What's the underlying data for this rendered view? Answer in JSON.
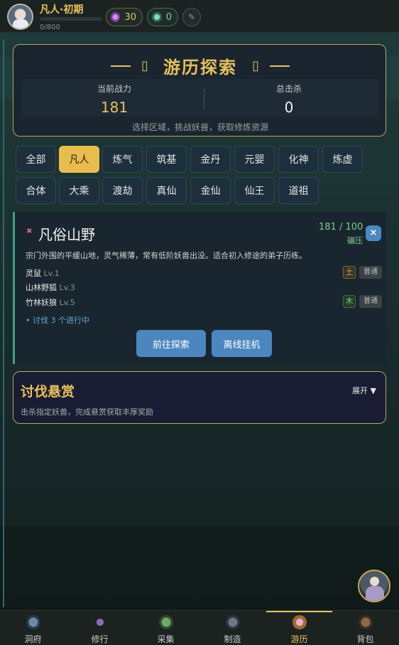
{
  "player": {
    "realm": "凡人·初期",
    "xp_text": "0/800",
    "xp_fraction": 0
  },
  "currency": {
    "spirit_stones": "30",
    "jade": "0"
  },
  "header": {
    "title": "游历探索",
    "bracket_left": "▯",
    "bracket_right": "▯",
    "combat_power_label": "当前战力",
    "combat_power_value": "181",
    "total_kills_label": "总击杀",
    "total_kills_value": "0",
    "hint": "选择区域，挑战妖兽，获取修炼资源"
  },
  "realm_tabs": [
    {
      "label": "全部"
    },
    {
      "label": "凡人"
    },
    {
      "label": "炼气"
    },
    {
      "label": "筑基"
    },
    {
      "label": "金丹"
    },
    {
      "label": "元婴"
    },
    {
      "label": "化神"
    },
    {
      "label": "炼虚"
    },
    {
      "label": "合体"
    },
    {
      "label": "大乘"
    },
    {
      "label": "渡劫"
    },
    {
      "label": "真仙"
    },
    {
      "label": "金仙"
    },
    {
      "label": "仙王"
    },
    {
      "label": "道祖"
    }
  ],
  "active_tab": "凡人",
  "zone": {
    "name": "凡俗山野",
    "power_ratio": "181 / 100",
    "status": "碾压",
    "close_symbol": "×",
    "description": "宗门外围的平缓山地，灵气稀薄，常有低阶妖兽出没。适合初入修途的弟子历练。",
    "monsters": [
      {
        "name": "灵鼠",
        "level": "Lv.1",
        "element": "土",
        "tier": "普通"
      },
      {
        "name": "山林野狐",
        "level": "Lv.3",
        "element": "",
        "tier": ""
      },
      {
        "name": "竹林妖狼",
        "level": "Lv.5",
        "element": "木",
        "tier": "普通"
      }
    ],
    "quest_note": "• 讨伐 3 个进行中",
    "explore_button": "前往探索",
    "afk_button": "离线挂机"
  },
  "bounty": {
    "title": "讨伐悬赏",
    "expand": "展开 ▼",
    "description": "击杀指定妖兽，完成悬赏获取丰厚奖励"
  },
  "bottom_nav": [
    {
      "label": "洞府",
      "icon": "cave-icon"
    },
    {
      "label": "修行",
      "icon": "cultivate-icon"
    },
    {
      "label": "采集",
      "icon": "gather-icon"
    },
    {
      "label": "制造",
      "icon": "craft-icon"
    },
    {
      "label": "游历",
      "icon": "explore-icon"
    },
    {
      "label": "背包",
      "icon": "bag-icon"
    }
  ],
  "active_nav": "游历",
  "colors": {
    "accent_gold": "#e7c05c",
    "button_blue": "#4c86bf",
    "status_green": "#7fcb8a"
  }
}
